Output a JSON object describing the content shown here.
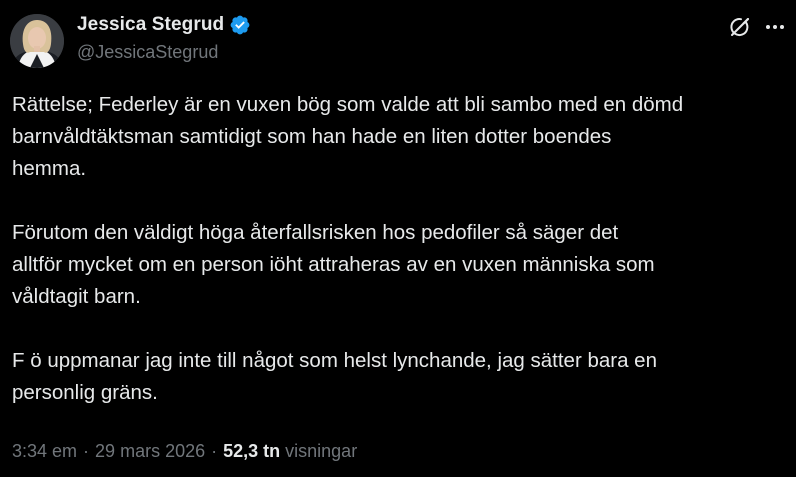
{
  "author": {
    "display_name": "Jessica Stegrud",
    "handle": "@JessicaStegrud",
    "verified": true,
    "verified_color": "#1d9bf0",
    "avatar_icon": "profile-photo"
  },
  "header_actions": {
    "grok_icon": "grok-icon",
    "more_icon": "more-dots-icon"
  },
  "body": {
    "paragraphs": [
      [
        "Rättelse; Federley är en vuxen bög som valde att bli sambo med en dömd",
        "barnvåldtäktsman samtidigt som han hade en liten dotter boendes",
        "hemma."
      ],
      [
        "Förutom den väldigt höga återfallsrisken hos pedofiler så säger det",
        "alltför mycket om en person iöht attraheras av en vuxen människa som",
        "våldtagit barn."
      ],
      [
        "F ö uppmanar jag inte till något som helst lynchande, jag sätter bara en",
        "personlig gräns."
      ]
    ]
  },
  "meta": {
    "time": "3:34 em",
    "separator": "·",
    "date": "29 mars 2026",
    "views_count": "52,3 tn",
    "views_label": "visningar"
  },
  "colors": {
    "background": "#000000",
    "primary_text": "#e7e9ea",
    "secondary_text": "#71767b"
  }
}
